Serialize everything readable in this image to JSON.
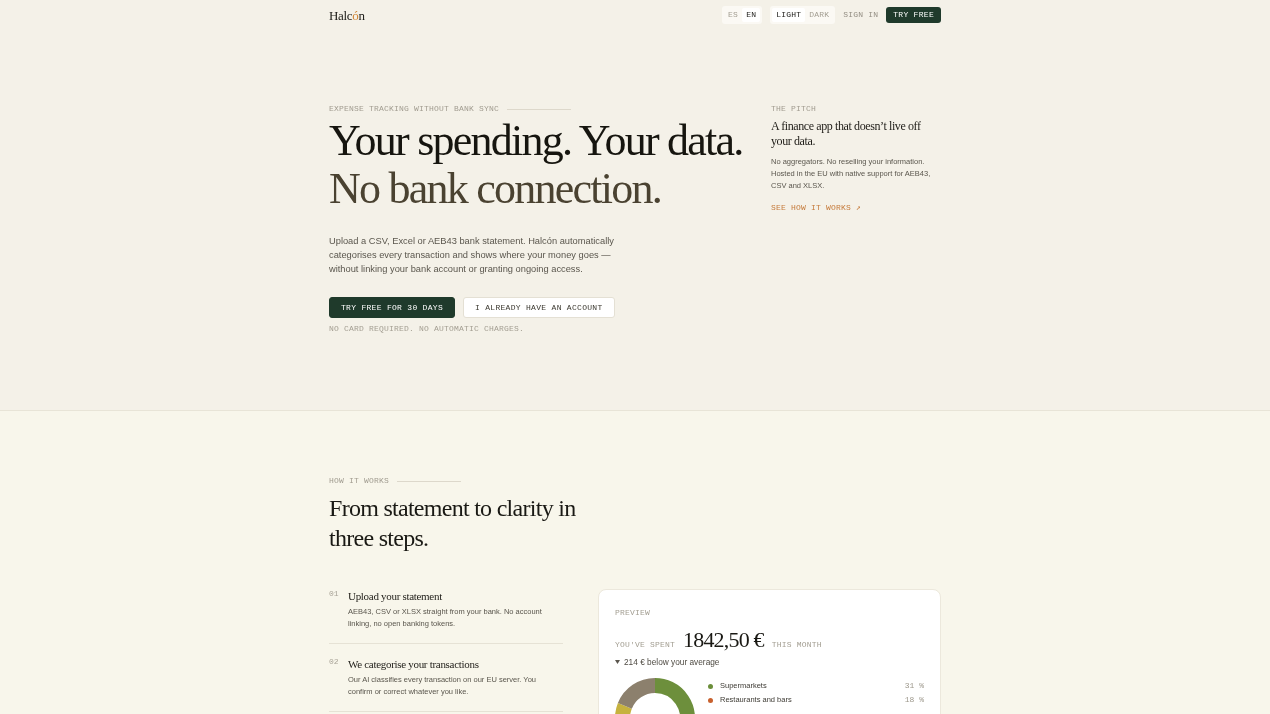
{
  "header": {
    "logo": [
      {
        "text": "Halc",
        "accent": false
      },
      {
        "text": "ó",
        "accent": true
      },
      {
        "text": "n",
        "accent": false
      }
    ],
    "language": [
      {
        "label": "ES",
        "selected": false
      },
      {
        "label": "EN",
        "selected": true
      }
    ],
    "theme": [
      {
        "label": "LIGHT",
        "selected": true
      },
      {
        "label": "DARK",
        "selected": false
      }
    ],
    "sign_in": "SIGN IN",
    "cta": "TRY FREE"
  },
  "hero": {
    "eyebrow": "EXPENSE TRACKING WITHOUT BANK SYNC",
    "heading": [
      {
        "text": "Your spending. Your data.",
        "muted": false
      },
      {
        "text": "No bank connection.",
        "muted": true
      }
    ],
    "intro": "Upload a CSV, Excel or AEB43 bank statement. Halcón automatically categorises every transaction and shows where your money goes — without linking your bank account or granting ongoing access.",
    "buttons": [
      {
        "label": "TRY FREE FOR 30 DAYS",
        "kind": "primary"
      },
      {
        "label": "I ALREADY HAVE AN ACCOUNT",
        "kind": "secondary"
      }
    ],
    "note": "NO CARD REQUIRED. NO AUTOMATIC CHARGES."
  },
  "pitch": {
    "eyebrow": "THE PITCH",
    "title": "A finance app that doesn’t live off your data.",
    "text": "No aggregators. No reselling your information. Hosted in the EU with native support for AEB43, CSV and XLSX.",
    "link": "SEE HOW IT WORKS ↗"
  },
  "how_it_works": {
    "eyebrow": "HOW IT WORKS",
    "heading": "From statement to clarity in three steps.",
    "steps": [
      {
        "number": "01",
        "title": "Upload your statement",
        "text": "AEB43, CSV or XLSX straight from your bank. No account linking, no open banking tokens."
      },
      {
        "number": "02",
        "title": "We categorise your transactions",
        "text": "Our AI classifies every transaction on our EU server. You confirm or correct whatever you like."
      }
    ],
    "preview": {
      "eyebrow": "PREVIEW",
      "spent_label": "YOU'VE SPENT",
      "amount": "1842,50 €",
      "period": "THIS MONTH",
      "trend": "214 € below your average",
      "legend": [
        {
          "label": "Supermarkets",
          "share": "31 %",
          "color": "#6b8e3a"
        },
        {
          "label": "Restaurants and bars",
          "share": "18 %",
          "color": "#c8612e"
        }
      ]
    }
  }
}
